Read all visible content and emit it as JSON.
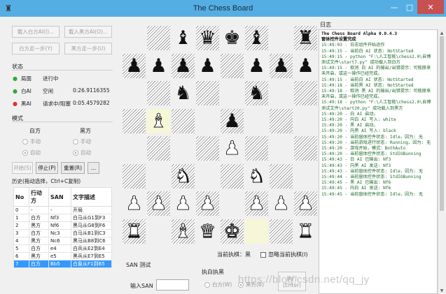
{
  "window": {
    "title": "The Chess Board",
    "app_icon": "chess-board-icon",
    "min_glyph": "—",
    "max_glyph": "□",
    "close_glyph": "✕"
  },
  "left": {
    "load_white_ai": "载入白方AI(I)...",
    "load_black_ai": "载入黑方AI(O)...",
    "white_step": "白方走一步(Y)",
    "black_step": "黑方走一步(U)",
    "status_group": "状态",
    "status_rows": [
      {
        "dot_color": "#2eaa3a",
        "name": "局面",
        "state": "进行中",
        "time": ""
      },
      {
        "dot_color": "#2eaa3a",
        "name": "白AI",
        "state": "空闲",
        "time": "0:26.9116355"
      },
      {
        "dot_color": "#e03030",
        "name": "黑AI",
        "state": "请求中/阻塞",
        "time": "0:05.4579282"
      }
    ],
    "mode_group": "模式",
    "white_label": "白方",
    "black_label": "黑方",
    "manual": "手动",
    "auto": "自动",
    "start_btn": "开始(S)",
    "stop_btn": "停止(P)",
    "reset_btn": "重置(R)",
    "more_btn": "...",
    "history_label": "历史(拖动选择，Ctrl+C复制)",
    "history_headers": [
      "No",
      "行动方",
      "SAN",
      "文字描述"
    ],
    "history_rows": [
      [
        "0",
        "-",
        "-",
        "开局"
      ],
      [
        "1",
        "白方",
        "Nf3",
        "白马从G1到F3"
      ],
      [
        "2",
        "黑方",
        "Nf6",
        "黑马从G8到F6"
      ],
      [
        "3",
        "白方",
        "Nc3",
        "白马从B1到C3"
      ],
      [
        "4",
        "黑方",
        "Nc6",
        "黑马从B8到C6"
      ],
      [
        "5",
        "白方",
        "e4",
        "白兵从E2到E4"
      ],
      [
        "6",
        "黑方",
        "e5",
        "黑兵从E7到E5"
      ],
      [
        "7",
        "白方",
        "Bb5",
        "白象从F1到B5"
      ]
    ],
    "selected_row": 7
  },
  "board": {
    "rows": [
      [
        "",
        "",
        "bb",
        "bq",
        "bk",
        "bb",
        "",
        "br"
      ],
      [
        "bp",
        "bp",
        "bp",
        "bp",
        "",
        "bp",
        "bp",
        "bp"
      ],
      [
        "",
        "",
        "bn",
        "",
        "",
        "bn",
        "",
        ""
      ],
      [
        "",
        "wb",
        "",
        "",
        "bp",
        "",
        "",
        ""
      ],
      [
        "",
        "",
        "",
        "",
        "wp",
        "",
        "",
        ""
      ],
      [
        "",
        "",
        "wn",
        "",
        "",
        "wn",
        "",
        ""
      ],
      [
        "wp",
        "wp",
        "wp",
        "wp",
        "",
        "wp",
        "wp",
        "wp"
      ],
      [
        "wr",
        "",
        "wb",
        "wq",
        "wk",
        "",
        "",
        "wr"
      ]
    ],
    "highlight_squares": [
      "b5",
      "f1"
    ]
  },
  "bottom": {
    "current_turn": "当前执棋：黑",
    "ignore_turn": "忽略当前执棋(I)",
    "san_test": "SAN 测试",
    "input_san": "输入SAN",
    "exec_group": "执白执黑",
    "white_w": "白方(W)",
    "black_b": "黑方(B)",
    "execute": "执行",
    "enter": "(Enter)"
  },
  "log": {
    "label": "日志",
    "lines": [
      {
        "t": "The Chess Board Alpha 0.0.4.3",
        "k": "black"
      },
      {
        "t": "窗体控件设置完成",
        "k": "black"
      },
      {
        "t": "15:49:03 - 日志组件开始运作",
        "k": "g"
      },
      {
        "t": "15:49:15 - 当前白 AI 状态: NotStarted",
        "k": "g"
      },
      {
        "t": "15:49:15 - python \"F:\\人工智能\\chess2.0\\自博测试文件\\start7.py\" 成功载入到白方",
        "k": "g"
      },
      {
        "t": "15:49:15 - 取消 白 AI 的输出/出错提示：可能原来未开启，或这一操作已经完成。",
        "k": "g"
      },
      {
        "t": "15:49:15 - 当前白 AI 状态: NotStarted",
        "k": "g"
      },
      {
        "t": "15:49:18 - 当前黑 AI 状态: NotStarted",
        "k": "g"
      },
      {
        "t": "15:49:18 - 取消 黑 AI 的输出/出错提示：可能原来未开启，或这一操作已经完成。",
        "k": "g"
      },
      {
        "t": "15:49:18 - python \"F:\\人工智能\\chess2.0\\自博测试文件\\start20.py\" 成功载入到黑方",
        "k": "g"
      },
      {
        "t": "15:49:20 - 白 AI 启动。",
        "k": "g"
      },
      {
        "t": "15:49:20 - 向白 AI 写入: white",
        "k": "g"
      },
      {
        "t": "15:49:20 - 黑 AI 启动。",
        "k": "g"
      },
      {
        "t": "15:49:20 - 向黑 AI 写入: black",
        "k": "g"
      },
      {
        "t": "15:49:20 - 当前窗体控件状态: Idle，因为: 无",
        "k": "g"
      },
      {
        "t": "15:49:20 - 当前游戏进行状态: Running，因为: 无",
        "k": "g"
      },
      {
        "t": "15:49:20 - 游戏开始，模式：BothAuto",
        "k": "g"
      },
      {
        "t": "15:49:20 - 当前窗体控件状态: StdIOBunning",
        "k": "g"
      },
      {
        "t": "15:49:43 - 白 AI 已输出: Nf3",
        "k": "g"
      },
      {
        "t": "15:49:43 - 向黑 AI 发送: Nf3",
        "k": "g"
      },
      {
        "t": "15:49:43 - 当前窗体控件状态: Idle，因为: 无",
        "k": "g"
      },
      {
        "t": "15:49:44 - 当前窗体控件状态: StdIOBunning",
        "k": "g"
      },
      {
        "t": "15:49:45 - 黑 AI 已输出: Nf6",
        "k": "g"
      },
      {
        "t": "15:49:45 - 向白 AI 发送: Nf6",
        "k": "g"
      },
      {
        "t": "15:49:45 - 当前窗体控件状态: Idle，因为: 无",
        "k": "g"
      }
    ]
  },
  "watermark": "https://blog.csdn.net/qq_jy"
}
